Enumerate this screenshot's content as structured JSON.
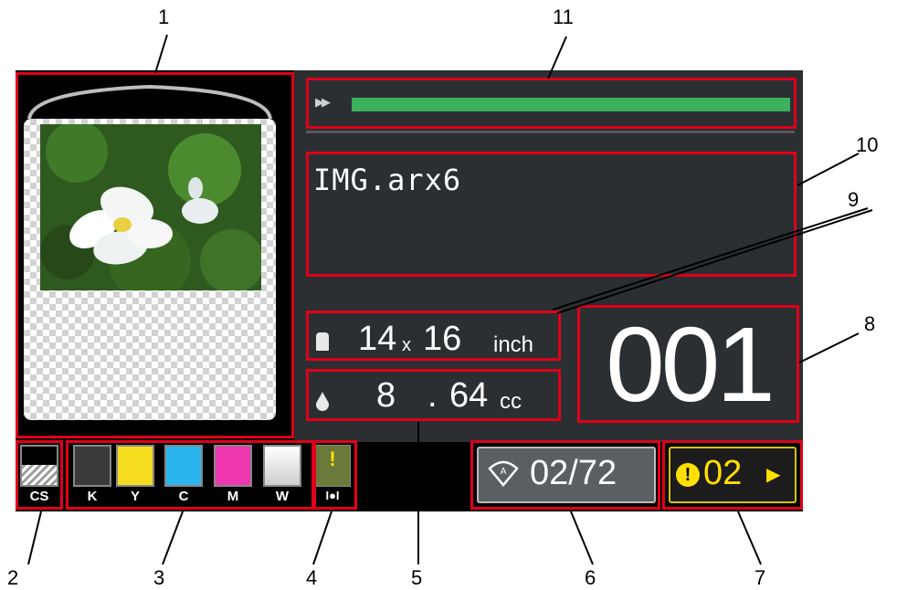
{
  "progress": {
    "icon": "fast-forward-icon",
    "fraction": 1.0
  },
  "file": {
    "name": "IMG.arx6"
  },
  "size": {
    "width": "14",
    "x": "x",
    "height": "16",
    "unit": "inch",
    "icon": "platen-icon"
  },
  "ink": {
    "whole": "8",
    "dot": ".",
    "fraction": "64",
    "unit": "cc",
    "icon": "ink-drop-icon"
  },
  "counter": {
    "value": "001"
  },
  "cartridges": [
    {
      "label": "CS"
    },
    {
      "label": "K",
      "color": "#3a3a3a"
    },
    {
      "label": "Y",
      "color": "#f5dc1e"
    },
    {
      "label": "C",
      "color": "#2bb5ee"
    },
    {
      "label": "M",
      "color": "#ee36b0"
    },
    {
      "label": "W",
      "color": "#e8e8e8"
    }
  ],
  "warning": {
    "mark": "!",
    "sub": "I●I"
  },
  "jobs": {
    "text": "02/72",
    "icon": "wifi-a-icon"
  },
  "errors": {
    "text": "02",
    "icon": "exclamation-icon",
    "mark": "!",
    "arrow": "▶"
  },
  "callouts": [
    "1",
    "2",
    "3",
    "4",
    "5",
    "6",
    "7",
    "8",
    "9",
    "10",
    "11"
  ],
  "colors": {
    "highlight": "#e0001a",
    "progress": "#3cb05a",
    "panel": "#2b2f32",
    "error": "#ffe000"
  }
}
